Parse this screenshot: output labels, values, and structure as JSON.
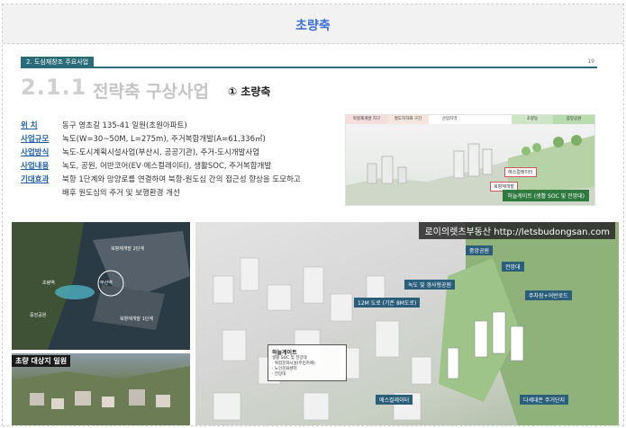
{
  "topbar": {
    "title": "초량축"
  },
  "section": {
    "tag": "2. 도심재창조 주요사업",
    "page_number": "19"
  },
  "heading": {
    "number": "2.1.1",
    "title": "전략축 구상사업",
    "subtitle": "① 초량축"
  },
  "info": [
    {
      "key": "위   치",
      "value": "동구 영초길 135-41 일원(초원아파트)"
    },
    {
      "key": "사업규모",
      "value": "녹도(W=30~50M, L=275m), 주거복합개발(A=61,336㎡)"
    },
    {
      "key": "사업방식",
      "value": "녹도-도시계획시설사업(부산시, 공공기관), 주거-도시개발사업"
    },
    {
      "key": "사업내용",
      "value": "녹도, 공원, 어반코어(EV·에스컬레이터), 생활SOC, 주거복합개발"
    },
    {
      "key": "기대효과",
      "value": "북항 1단계와 망양로를 연결하여 북항-원도심 간의 접근성 향상을 도모하고"
    }
  ],
  "info_extra": "배후 원도심의 주거 및 보행환경 개선",
  "section_render": {
    "legend": [
      "북항재개발 지구",
      "철도지하화 구간",
      "산업지역",
      "",
      "초량동",
      "중앙공원"
    ],
    "labels": [
      "북항재개발",
      "에스컬레이터",
      "허늘게이트 (생활 SOC 및 전망대)"
    ]
  },
  "map": {
    "labels": [
      "북항재개발 2단계",
      "초량역",
      "부산역",
      "북항재개발 1단계",
      "중앙공원"
    ],
    "bottom_label": "초량 대상지 일원"
  },
  "aerial": {
    "watermark": "로이의렛츠부동산 http://letsbudongsan.com",
    "tags": [
      "중앙공원",
      "전망대",
      "녹도 및 경사형공원",
      "주차장+어반로드",
      "12M 도로 (기존 8M도로)",
      "에스컬레이터",
      "다세대존 주거단지"
    ],
    "callout_title": "하늘게이트",
    "callout_lines": [
      "생활 SOC 및 전망대",
      "· 복합문화시설(주민카페)",
      "· 노인문화센터",
      "· 전망대"
    ]
  }
}
